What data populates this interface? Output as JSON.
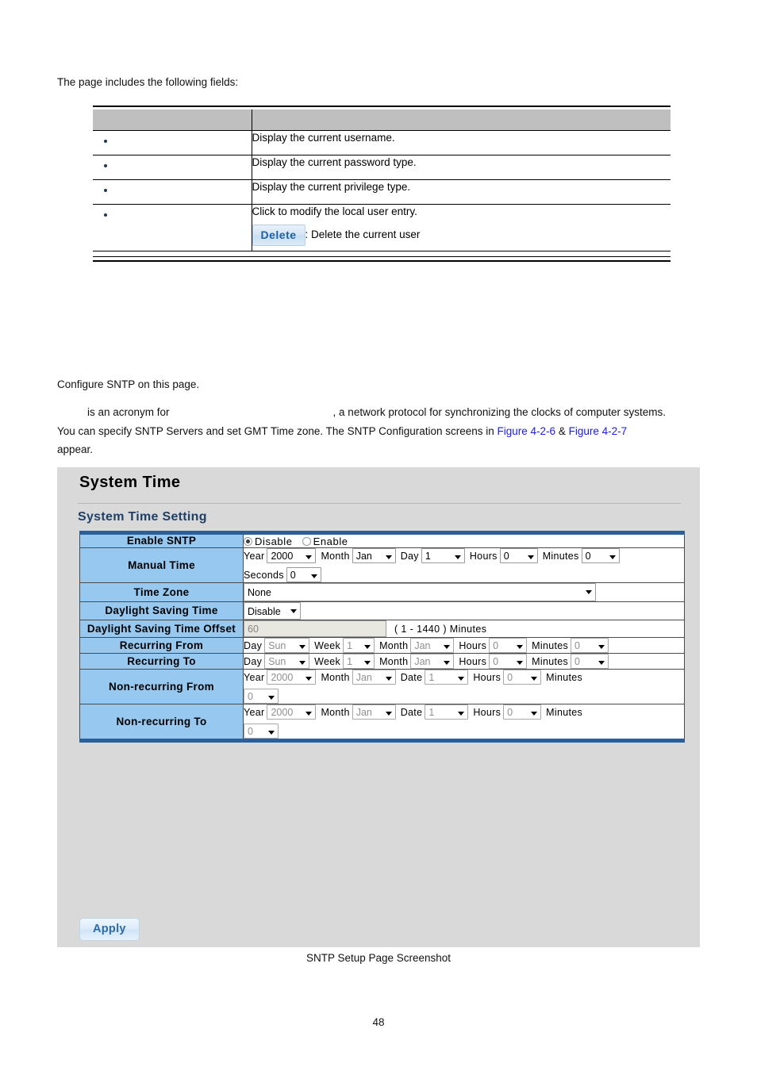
{
  "document": {
    "intro_line": "The page includes the following fields:",
    "fields_table": {
      "header": {
        "col_object": "",
        "col_description": ""
      },
      "rows": [
        {
          "object": "",
          "description": "Display the current username."
        },
        {
          "object": "",
          "description": "Display the current password type."
        },
        {
          "object": "",
          "description": "Display the current privilege type."
        },
        {
          "object": "",
          "description": "Click to modify the local user entry.",
          "button_label": "Delete",
          "button_description": ": Delete the current user"
        }
      ]
    },
    "paragraphs": {
      "configure_line": "Configure SNTP on this page.",
      "acronym_pre": "",
      "acronym_mid": "is an acronym for",
      "acronym_post": ", a network protocol for synchronizing the clocks of computer systems.",
      "line2_a": "You can specify SNTP Servers and set GMT Time zone. The SNTP Configuration screens in ",
      "link1": "Figure 4-2-6",
      "amp": " & ",
      "link2": "Figure 4-2-7",
      "line3": "appear."
    },
    "caption": "SNTP Setup Page Screenshot",
    "page_number": "48"
  },
  "ui": {
    "title": "System Time",
    "subtitle": "System Time Setting",
    "apply_label": "Apply",
    "rows": {
      "enable_sntp": {
        "label": "Enable SNTP",
        "options": [
          {
            "label": "Disable",
            "selected": true
          },
          {
            "label": "Enable",
            "selected": false
          }
        ]
      },
      "manual_time": {
        "label": "Manual Time",
        "year_label": "Year",
        "year_value": "2000",
        "month_label": "Month",
        "month_value": "Jan",
        "day_label": "Day",
        "day_value": "1",
        "hours_label": "Hours",
        "hours_value": "0",
        "minutes_label": "Minutes",
        "minutes_value": "0",
        "seconds_label": "Seconds",
        "seconds_value": "0"
      },
      "time_zone": {
        "label": "Time Zone",
        "value": "None"
      },
      "daylight_saving_time": {
        "label": "Daylight Saving Time",
        "value": "Disable"
      },
      "daylight_saving_time_offset": {
        "label": "Daylight Saving Time Offset",
        "value": "60",
        "hint": "( 1 - 1440 ) Minutes"
      },
      "recurring_from": {
        "label": "Recurring From",
        "day_label": "Day",
        "day_value": "Sun",
        "week_label": "Week",
        "week_value": "1",
        "month_label": "Month",
        "month_value": "Jan",
        "hours_label": "Hours",
        "hours_value": "0",
        "minutes_label": "Minutes",
        "minutes_value": "0"
      },
      "recurring_to": {
        "label": "Recurring To",
        "day_label": "Day",
        "day_value": "Sun",
        "week_label": "Week",
        "week_value": "1",
        "month_label": "Month",
        "month_value": "Jan",
        "hours_label": "Hours",
        "hours_value": "0",
        "minutes_label": "Minutes",
        "minutes_value": "0"
      },
      "non_recurring_from": {
        "label": "Non-recurring From",
        "year_label": "Year",
        "year_value": "2000",
        "month_label": "Month",
        "month_value": "Jan",
        "date_label": "Date",
        "date_value": "1",
        "hours_label": "Hours",
        "hours_value": "0",
        "minutes_label": "Minutes",
        "minutes_value": "0"
      },
      "non_recurring_to": {
        "label": "Non-recurring To",
        "year_label": "Year",
        "year_value": "2000",
        "month_label": "Month",
        "month_value": "Jan",
        "date_label": "Date",
        "date_value": "1",
        "hours_label": "Hours",
        "hours_value": "0",
        "minutes_label": "Minutes",
        "minutes_value": "0"
      }
    }
  },
  "colors": {
    "panel_bg": "#d9d9d9",
    "label_bg": "#96c8f0",
    "accent_border": "#2a6099",
    "link": "#1a1af0",
    "table_header_bg": "#bfbfbf"
  }
}
